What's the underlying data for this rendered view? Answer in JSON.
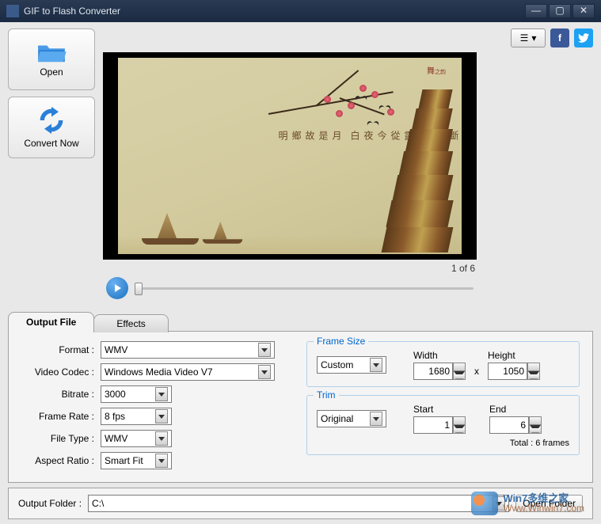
{
  "window": {
    "title": "GIF to Flash Converter"
  },
  "buttons": {
    "open": "Open",
    "convert": "Convert Now",
    "open_folder": "Open Folder"
  },
  "preview": {
    "frame_counter": "1 of 6"
  },
  "tabs": {
    "output": "Output File",
    "effects": "Effects"
  },
  "form": {
    "format_label": "Format :",
    "format_value": "WMV",
    "codec_label": "Video Codec :",
    "codec_value": "Windows Media Video V7",
    "bitrate_label": "Bitrate :",
    "bitrate_value": "3000",
    "framerate_label": "Frame Rate :",
    "framerate_value": "8 fps",
    "filetype_label": "File Type :",
    "filetype_value": "WMV",
    "aspect_label": "Aspect Ratio :",
    "aspect_value": "Smart Fit"
  },
  "frame_size": {
    "legend": "Frame Size",
    "mode": "Custom",
    "width_label": "Width",
    "width_value": "1680",
    "height_label": "Height",
    "height_value": "1050"
  },
  "trim": {
    "legend": "Trim",
    "mode": "Original",
    "start_label": "Start",
    "start_value": "1",
    "end_label": "End",
    "end_value": "6",
    "total": "Total : 6 frames"
  },
  "output": {
    "label": "Output Folder :",
    "value": "C:\\"
  },
  "watermark": {
    "line1": "Win7多维之家",
    "line2": "Www.Winwin7.com"
  }
}
